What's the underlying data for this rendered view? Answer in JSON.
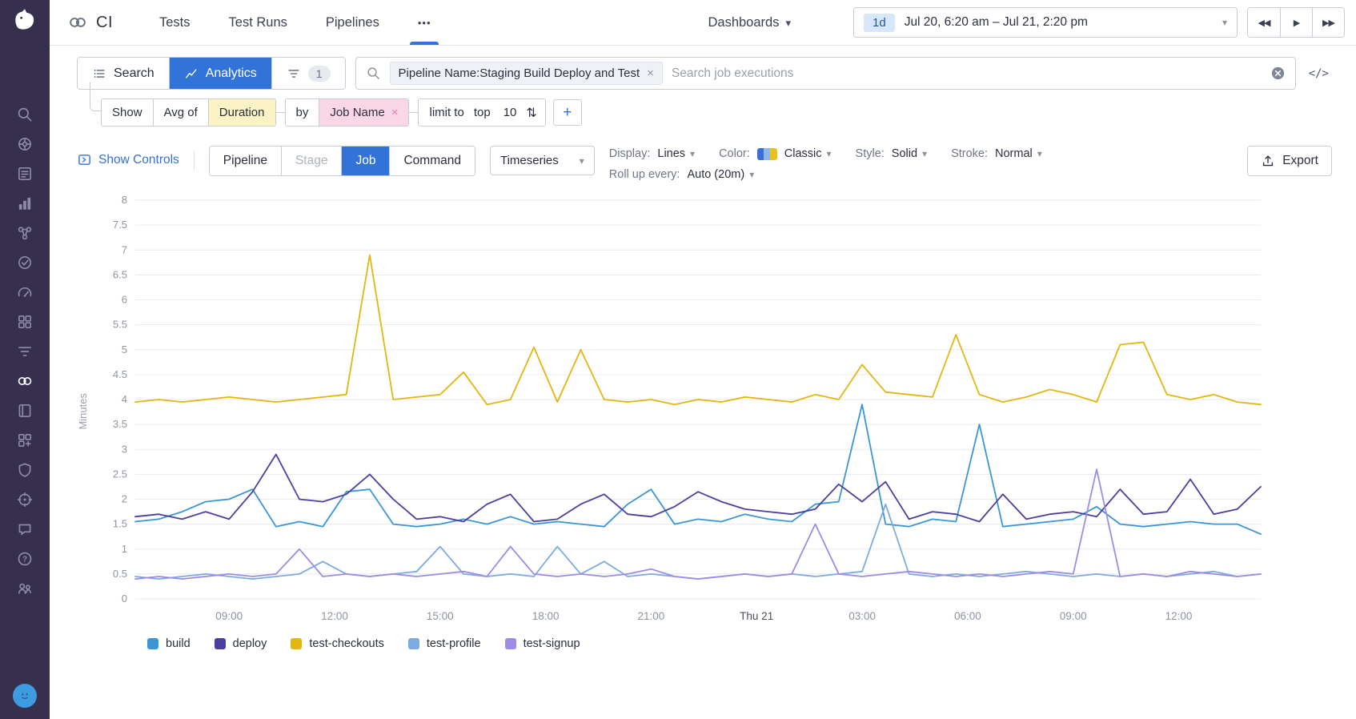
{
  "glyphs": {
    "caret": "▾",
    "close": "×",
    "more": "•••",
    "code_toggle": "</>",
    "sort": "⇅",
    "plus": "+",
    "skip_back": "◀◀",
    "play": "▶",
    "skip_forward": "▶▶"
  },
  "ui_colors": {
    "accent_blue": "#3273d9",
    "sidebar_bg": "#36304e",
    "highlight_yellow": "#fbf3c4",
    "highlight_pink": "#f9d7e7"
  },
  "sidebar": {
    "icons": [
      "search",
      "infrastructure",
      "logs",
      "metrics",
      "service-map",
      "synthetics",
      "apm",
      "integrations",
      "pipelines",
      "ci-visibility",
      "notebooks",
      "services",
      "security",
      "watchdog",
      "support",
      "help",
      "organization"
    ],
    "active_icon": "ci-visibility"
  },
  "topbar": {
    "product": "CI",
    "nav": [
      "Tests",
      "Test Runs",
      "Pipelines"
    ],
    "dashboards_label": "Dashboards",
    "time_range": {
      "preset": "1d",
      "label": "Jul 20, 6:20 am – Jul 21, 2:20 pm"
    }
  },
  "search_bar": {
    "search_label": "Search",
    "analytics_label": "Analytics",
    "filter_count": "1",
    "filter_pill": "Pipeline Name:Staging Build Deploy and Test",
    "placeholder": "Search job executions"
  },
  "query_builder": {
    "show_label": "Show",
    "aggregation": "Avg of",
    "measure": "Duration",
    "by_label": "by",
    "group_by": "Job Name",
    "limit_label": "limit to",
    "limit_direction": "top",
    "limit_value": "10"
  },
  "controls": {
    "show_controls_label": "Show Controls",
    "levels": [
      "Pipeline",
      "Stage",
      "Job",
      "Command"
    ],
    "active_level": "Job",
    "disabled_level": "Stage",
    "viz_type": "Timeseries",
    "display_label": "Display:",
    "display_value": "Lines",
    "color_label": "Color:",
    "color_value": "Classic",
    "palette_colors": [
      "#3970d8",
      "#8fb8ea",
      "#e8c21a"
    ],
    "style_label": "Style:",
    "style_value": "Solid",
    "stroke_label": "Stroke:",
    "stroke_value": "Normal",
    "rollup_label": "Roll up every:",
    "rollup_value": "Auto (20m)",
    "export_label": "Export"
  },
  "chart_data": {
    "type": "line",
    "ylabel": "Minutes",
    "ylim": [
      0,
      8
    ],
    "y_tick_step": 0.5,
    "x_start_label": "Jul 20 06:20",
    "x_span_hours": 32,
    "x_interval_hours": 0.6666667,
    "x_ticks": [
      {
        "offset_hours": 2.667,
        "label": "09:00"
      },
      {
        "offset_hours": 5.667,
        "label": "12:00"
      },
      {
        "offset_hours": 8.667,
        "label": "15:00"
      },
      {
        "offset_hours": 11.667,
        "label": "18:00"
      },
      {
        "offset_hours": 14.667,
        "label": "21:00"
      },
      {
        "offset_hours": 17.667,
        "label": "Thu 21",
        "emphasis": true
      },
      {
        "offset_hours": 20.667,
        "label": "03:00"
      },
      {
        "offset_hours": 23.667,
        "label": "06:00"
      },
      {
        "offset_hours": 26.667,
        "label": "09:00"
      },
      {
        "offset_hours": 29.667,
        "label": "12:00"
      }
    ],
    "series": [
      {
        "name": "build",
        "color": "#3a96d5",
        "values": [
          1.55,
          1.6,
          1.75,
          1.95,
          2.0,
          2.2,
          1.45,
          1.55,
          1.45,
          2.15,
          2.2,
          1.5,
          1.45,
          1.5,
          1.6,
          1.5,
          1.65,
          1.5,
          1.55,
          1.5,
          1.45,
          1.9,
          2.2,
          1.5,
          1.6,
          1.55,
          1.7,
          1.6,
          1.55,
          1.9,
          1.95,
          3.9,
          1.5,
          1.45,
          1.6,
          1.55,
          3.5,
          1.45,
          1.5,
          1.55,
          1.6,
          1.85,
          1.5,
          1.45,
          1.5,
          1.55,
          1.5,
          1.5,
          1.3
        ]
      },
      {
        "name": "deploy",
        "color": "#4a3f9e",
        "values": [
          1.65,
          1.7,
          1.6,
          1.75,
          1.6,
          2.15,
          2.9,
          2.0,
          1.95,
          2.1,
          2.5,
          2.0,
          1.6,
          1.65,
          1.55,
          1.9,
          2.1,
          1.55,
          1.6,
          1.9,
          2.1,
          1.7,
          1.65,
          1.85,
          2.15,
          1.95,
          1.8,
          1.75,
          1.7,
          1.8,
          2.3,
          1.95,
          2.35,
          1.6,
          1.75,
          1.7,
          1.55,
          2.1,
          1.6,
          1.7,
          1.75,
          1.65,
          2.2,
          1.7,
          1.75,
          2.4,
          1.7,
          1.8,
          2.25
        ]
      },
      {
        "name": "test-checkouts",
        "color": "#e3b610",
        "values": [
          3.95,
          4.0,
          3.95,
          4.0,
          4.05,
          4.0,
          3.95,
          4.0,
          4.05,
          4.1,
          6.9,
          4.0,
          4.05,
          4.1,
          4.55,
          3.9,
          4.0,
          5.05,
          3.95,
          5.0,
          4.0,
          3.95,
          4.0,
          3.9,
          4.0,
          3.95,
          4.05,
          4.0,
          3.95,
          4.1,
          4.0,
          4.7,
          4.15,
          4.1,
          4.05,
          5.3,
          4.1,
          3.95,
          4.05,
          4.2,
          4.1,
          3.95,
          5.1,
          5.15,
          4.1,
          4.0,
          4.1,
          3.95,
          3.9
        ]
      },
      {
        "name": "test-profile",
        "color": "#7cabe2",
        "values": [
          0.45,
          0.4,
          0.45,
          0.5,
          0.45,
          0.4,
          0.45,
          0.5,
          0.75,
          0.5,
          0.45,
          0.5,
          0.55,
          1.05,
          0.5,
          0.45,
          0.5,
          0.45,
          1.05,
          0.5,
          0.75,
          0.45,
          0.5,
          0.45,
          0.4,
          0.45,
          0.5,
          0.45,
          0.5,
          0.45,
          0.5,
          0.55,
          1.9,
          0.5,
          0.45,
          0.5,
          0.45,
          0.5,
          0.55,
          0.5,
          0.45,
          0.5,
          0.45,
          0.5,
          0.45,
          0.5,
          0.55,
          0.45,
          0.5
        ]
      },
      {
        "name": "test-signup",
        "color": "#9e8ce4",
        "values": [
          0.4,
          0.45,
          0.4,
          0.45,
          0.5,
          0.45,
          0.5,
          1.0,
          0.45,
          0.5,
          0.45,
          0.5,
          0.45,
          0.5,
          0.55,
          0.45,
          1.05,
          0.5,
          0.45,
          0.5,
          0.45,
          0.5,
          0.6,
          0.45,
          0.4,
          0.45,
          0.5,
          0.45,
          0.5,
          1.5,
          0.5,
          0.45,
          0.5,
          0.55,
          0.5,
          0.45,
          0.5,
          0.45,
          0.5,
          0.55,
          0.5,
          2.6,
          0.45,
          0.5,
          0.45,
          0.55,
          0.5,
          0.45,
          0.5
        ]
      }
    ]
  }
}
